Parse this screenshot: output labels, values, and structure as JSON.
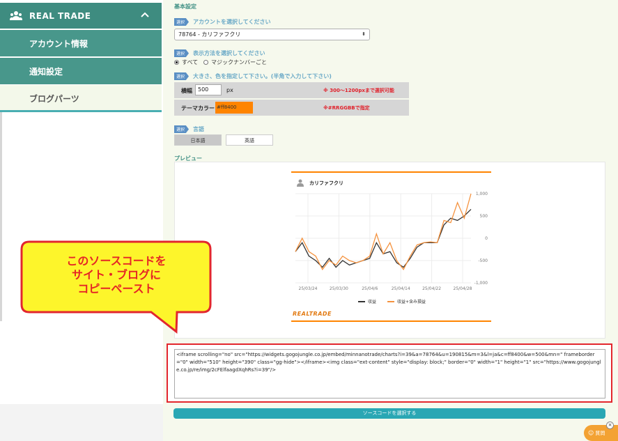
{
  "sidebar": {
    "title": "REAL TRADE",
    "items": [
      {
        "label": "アカウント情報"
      },
      {
        "label": "通知設定"
      },
      {
        "label": "ブログパーツ"
      }
    ]
  },
  "settings": {
    "section_title": "基本設定",
    "badge": "選択",
    "account_label": "アカウントを選択してください",
    "account_value": "78764 - カリファフクリ",
    "display_label": "表示方法を選択してください",
    "display_options": [
      "すべて",
      "マジックナンバーごと"
    ],
    "size_label": "大きさ、色を指定して下さい。(半角で入力して下さい)",
    "width_label": "横幅",
    "width_value": "500",
    "width_unit": "px",
    "width_note": "※ 300〜1200pxまで選択可能",
    "color_label": "テーマカラー",
    "color_value": "#ff8400",
    "color_note": "※#RRGGBBで指定",
    "lang_label": "言語",
    "lang_options": [
      "日本語",
      "英語"
    ],
    "preview_label": "プレビュー"
  },
  "widget": {
    "account_name": "カリファフクリ",
    "logo": "REALTRADE",
    "theme_color": "#ff8400"
  },
  "chart_data": {
    "type": "line",
    "x": [
      "25/03/24",
      "25/03/30",
      "25/04/6",
      "25/04/14",
      "25/04/22",
      "25/04/28"
    ],
    "ylim": [
      -1000,
      1000
    ],
    "yticks": [
      "1,000",
      "500",
      "0",
      "-500",
      "-1,000"
    ],
    "grid": true,
    "legend": "bottom",
    "series": [
      {
        "name": "収益",
        "color": "#333333",
        "values": [
          -300,
          -100,
          -400,
          -500,
          -650,
          -450,
          -650,
          -500,
          -600,
          -550,
          -500,
          -450,
          -100,
          -350,
          -300,
          -550,
          -650,
          -450,
          -200,
          -100,
          -100,
          -100,
          300,
          450,
          400,
          500,
          650
        ]
      },
      {
        "name": "収益+含み損益",
        "color": "#f5923e",
        "values": [
          -300,
          0,
          -300,
          -400,
          -700,
          -500,
          -600,
          -400,
          -500,
          -550,
          -500,
          -400,
          100,
          -350,
          -100,
          -500,
          -700,
          -400,
          -150,
          -100,
          -80,
          -100,
          400,
          350,
          800,
          450,
          1000
        ]
      }
    ]
  },
  "code": {
    "source": "<iframe scrolling=\"no\" src=\"https://widgets.gogojungle.co.jp/embed/minnanotrade/charts?i=39&a=78764&u=190815&m=3&l=ja&c=ff8400&w=500&mn=\" frameborder=\"0\" width=\"510\" height=\"390\" class=\"gg-hide\"></iframe><img class=\"ext-content\" style=\"display: block;\" border=\"0\" width=\"1\" height=\"1\" src=\"https://www.gogojungle.co.jp/re/img/2cFElfaagdXqhRs?i=39\"/>",
    "select_button": "ソースコードを選択する"
  },
  "callout": {
    "lines": [
      "このソースコードを",
      "サイト・ブログに",
      "コピーペースト"
    ]
  },
  "help": {
    "label": "質問",
    "close": "×"
  }
}
